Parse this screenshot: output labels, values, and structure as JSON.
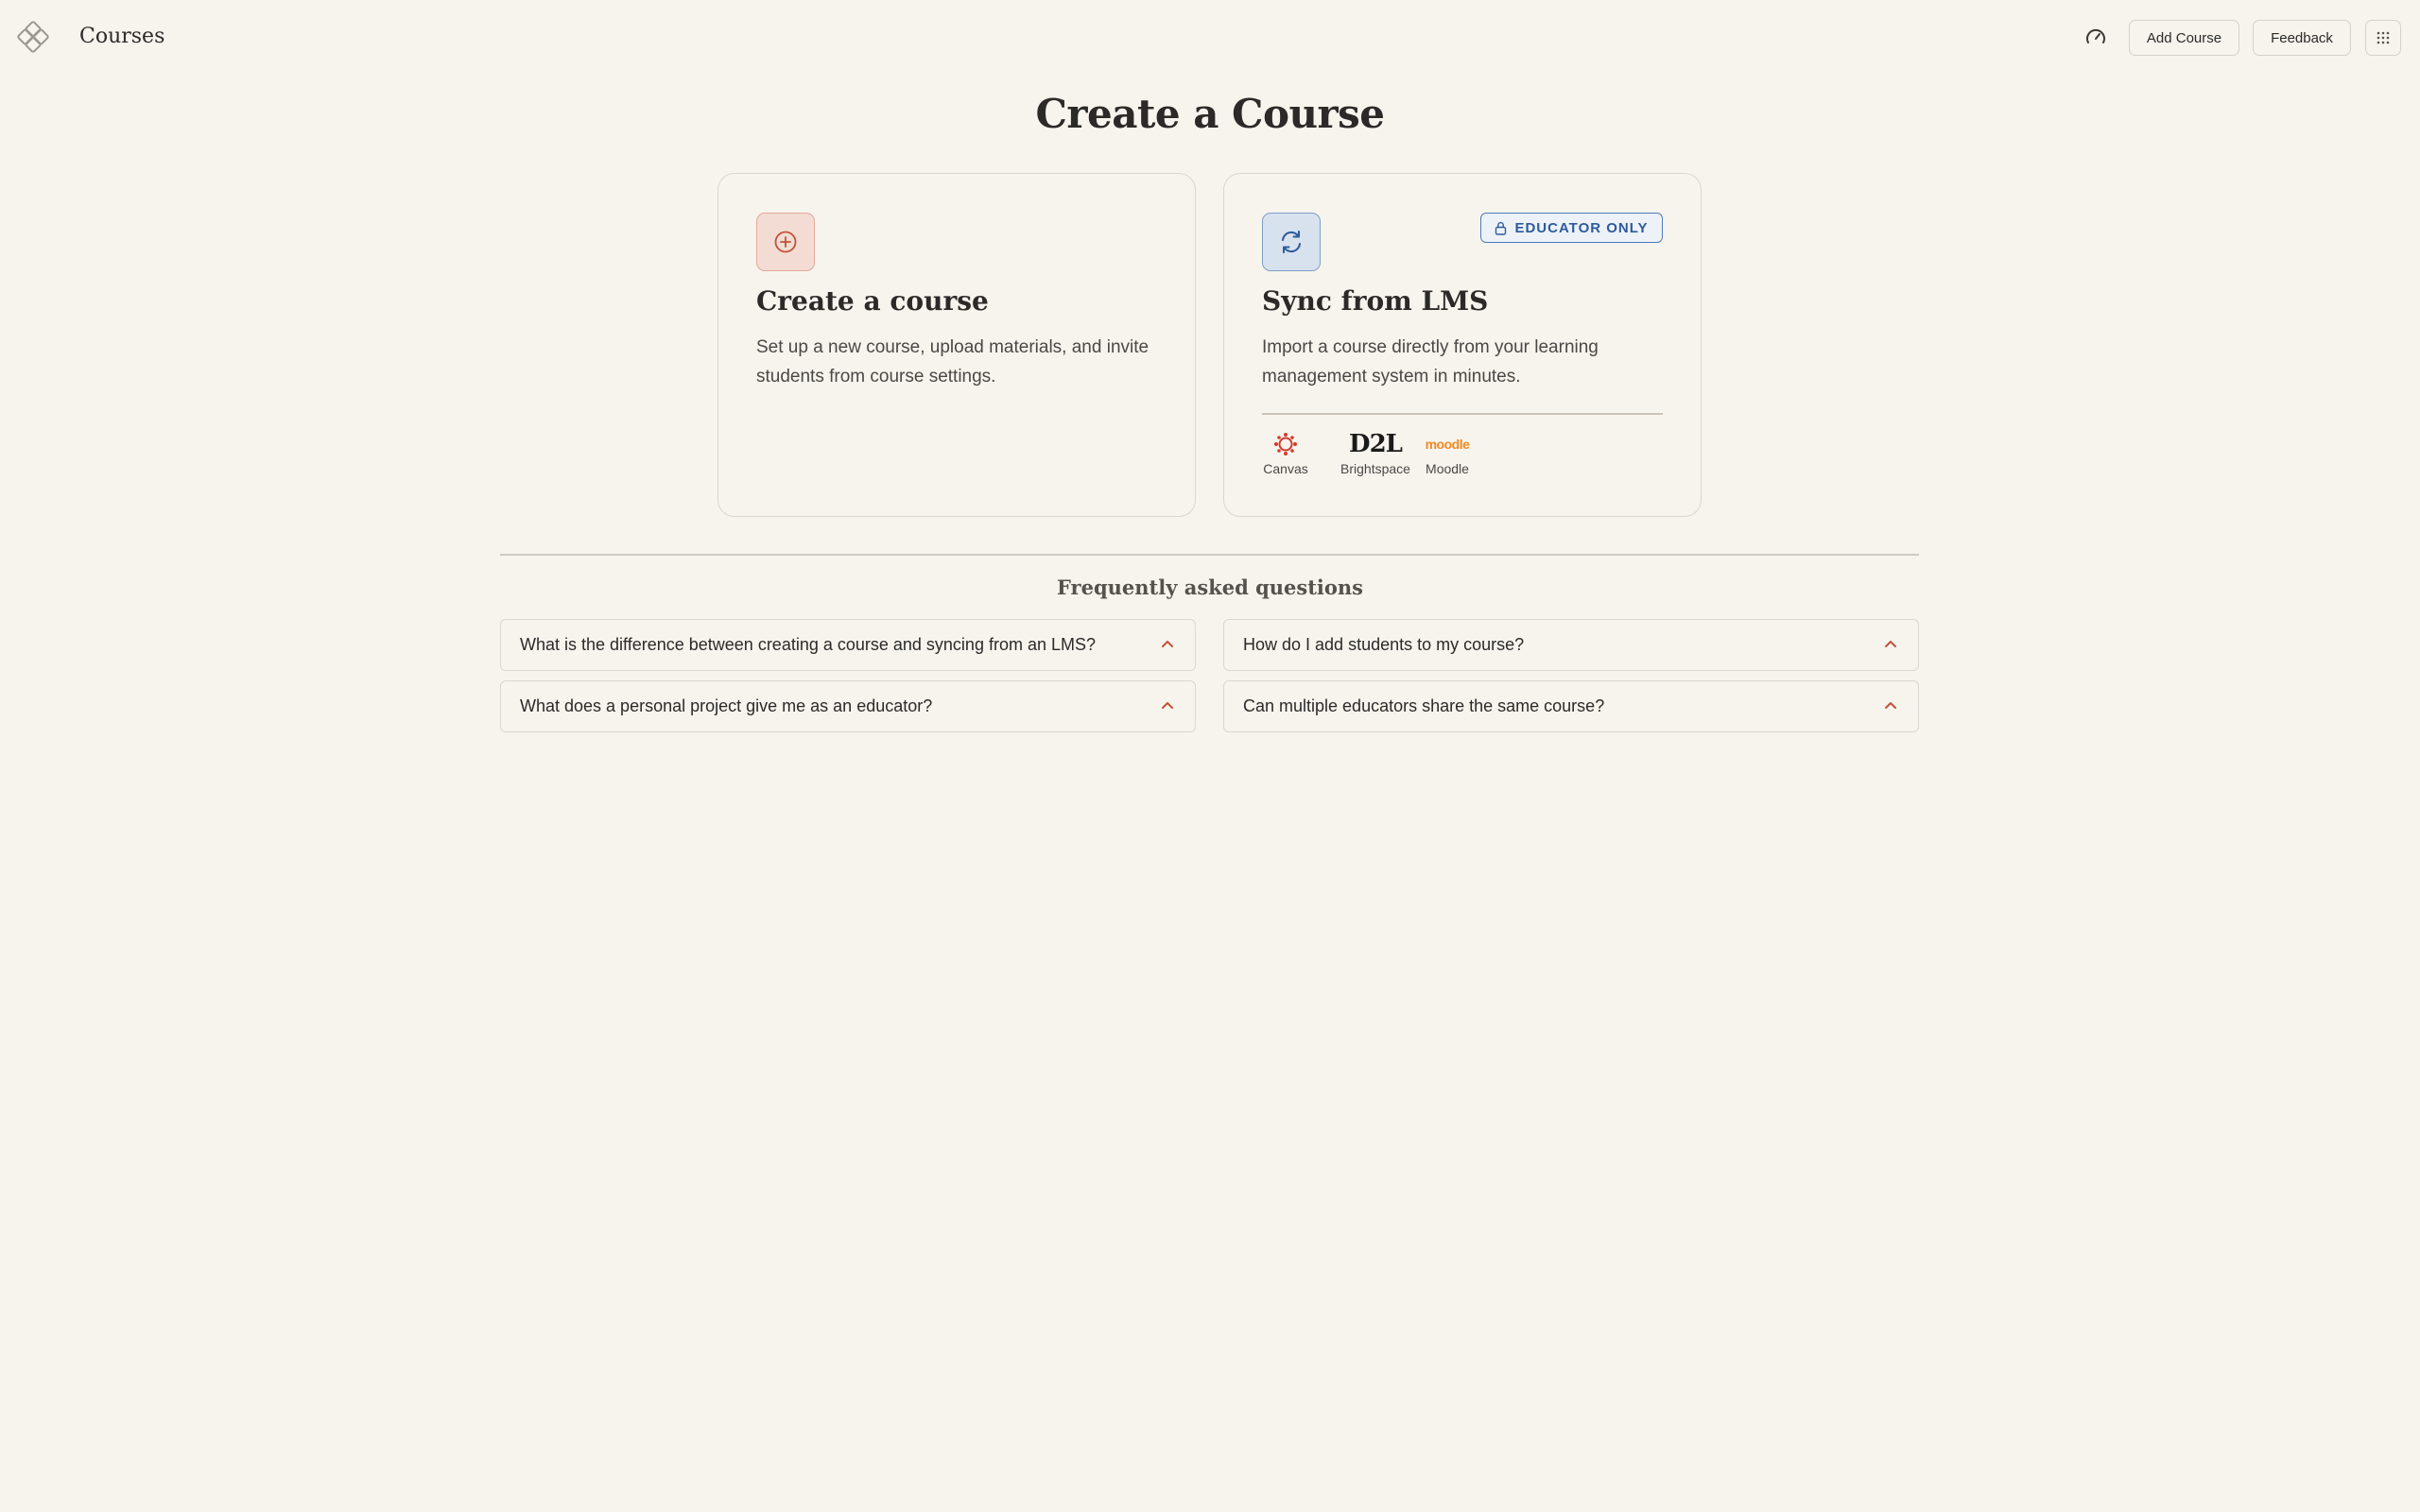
{
  "header": {
    "title": "Courses",
    "add_course_label": "Add Course",
    "feedback_label": "Feedback"
  },
  "main": {
    "title": "Create a Course"
  },
  "cards": {
    "create": {
      "title": "Create a course",
      "description": "Set up a new course, upload materials, and invite students from course settings."
    },
    "sync": {
      "title": "Sync from LMS",
      "description": "Import a course directly from your learning management system in minutes.",
      "badge": "EDUCATOR ONLY",
      "platforms": [
        {
          "label": "Canvas",
          "logo_text": ""
        },
        {
          "label": "Brightspace",
          "logo_text": "D2L"
        },
        {
          "label": "Moodle",
          "logo_text": "moodle"
        }
      ]
    }
  },
  "faq": {
    "title": "Frequently asked questions",
    "items": [
      {
        "question": "What is the difference between creating a course and syncing from an LMS?"
      },
      {
        "question": "How do I add students to my course?"
      },
      {
        "question": "What does a personal project give me as an educator?"
      },
      {
        "question": "Can multiple educators share the same course?"
      }
    ]
  },
  "colors": {
    "background": "#f7f4ee",
    "accent_red": "#c0533a",
    "accent_blue": "#2d5b9a",
    "moodle_orange": "#f08a24"
  },
  "icons": {
    "logo": "diamond-logo-icon",
    "speed": "gauge-icon",
    "grid": "grid-dots-icon",
    "create": "plus-circle-icon",
    "sync": "refresh-icon",
    "lock": "lock-icon",
    "chevron": "chevron-up-icon"
  }
}
